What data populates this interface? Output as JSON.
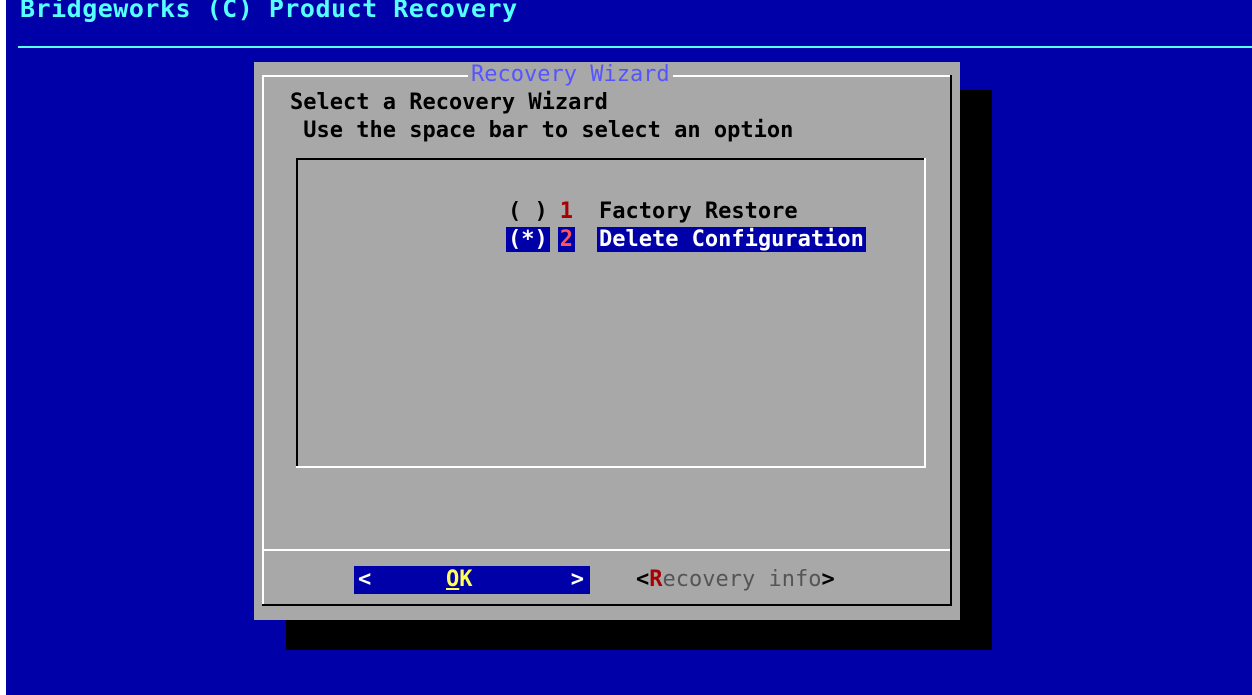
{
  "backtitle": "Bridgeworks (C) Product Recovery",
  "dialog": {
    "title": "Recovery Wizard",
    "prompt_line1": "Select a Recovery Wizard",
    "prompt_line2": " Use the space bar to select an option",
    "options": [
      {
        "mark": "( )",
        "tag": "1",
        "label": "Factory Restore",
        "selected": false
      },
      {
        "mark": "(*)",
        "tag": "2",
        "label": "Delete Configuration",
        "selected": true
      }
    ],
    "buttons": {
      "ok": {
        "left": "<",
        "hotkey": "O",
        "rest": "K",
        "right": ">"
      },
      "info": {
        "open": "<",
        "hotkey": "R",
        "rest": "ecovery info",
        "close": ">"
      }
    }
  },
  "colors": {
    "background": "#0000a8",
    "backtitle": "#55ffff",
    "dialog": "#a8a8a8",
    "title": "#5555ff",
    "highlight": "#0000a8",
    "tag": "#a80000",
    "hotkey_ok": "#ffff55"
  }
}
